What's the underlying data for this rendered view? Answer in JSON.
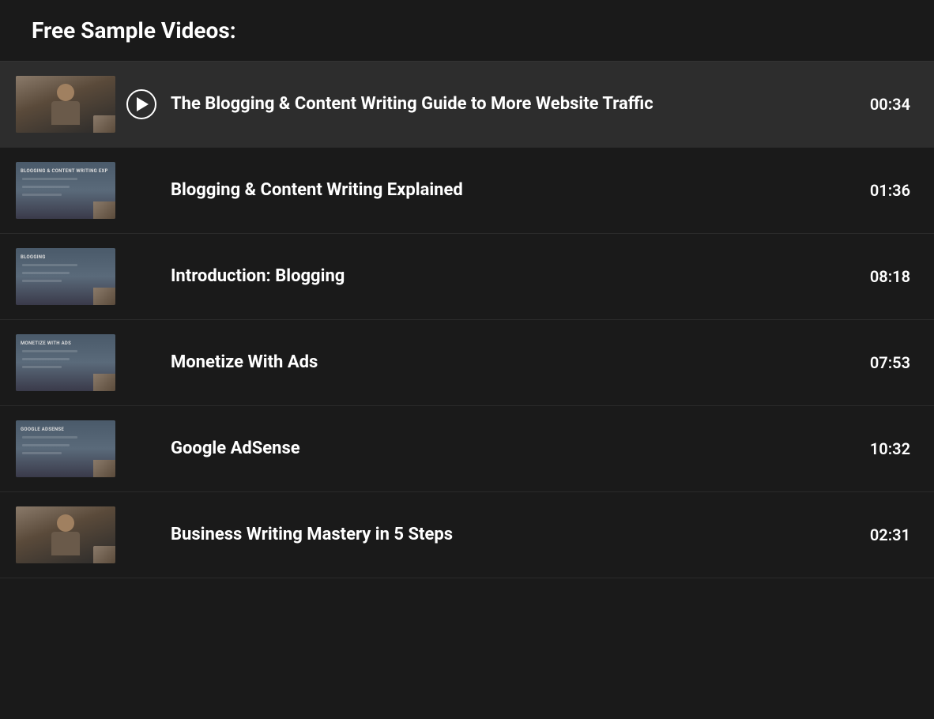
{
  "header": {
    "title": "Free Sample Videos:"
  },
  "videos": [
    {
      "id": "video-1",
      "title": "The Blogging & Content Writing Guide to More Website Traffic",
      "duration": "00:34",
      "thumbnail_type": "person",
      "active": true,
      "has_play_button": true,
      "thumbnail_label": ""
    },
    {
      "id": "video-2",
      "title": "Blogging & Content Writing Explained",
      "duration": "01:36",
      "thumbnail_type": "screen",
      "active": false,
      "has_play_button": false,
      "thumbnail_label": "BLOGGING & CONTENT WRITING EXPLAINED"
    },
    {
      "id": "video-3",
      "title": "Introduction: Blogging",
      "duration": "08:18",
      "thumbnail_type": "screen",
      "active": false,
      "has_play_button": false,
      "thumbnail_label": "BLOGGING"
    },
    {
      "id": "video-4",
      "title": "Monetize With Ads",
      "duration": "07:53",
      "thumbnail_type": "screen",
      "active": false,
      "has_play_button": false,
      "thumbnail_label": "MONETIZE WITH ADS"
    },
    {
      "id": "video-5",
      "title": "Google AdSense",
      "duration": "10:32",
      "thumbnail_type": "screen",
      "active": false,
      "has_play_button": false,
      "thumbnail_label": "GOOGLE ADSENSE"
    },
    {
      "id": "video-6",
      "title": "Business Writing Mastery in 5 Steps",
      "duration": "02:31",
      "thumbnail_type": "person",
      "active": false,
      "has_play_button": false,
      "thumbnail_label": ""
    }
  ]
}
